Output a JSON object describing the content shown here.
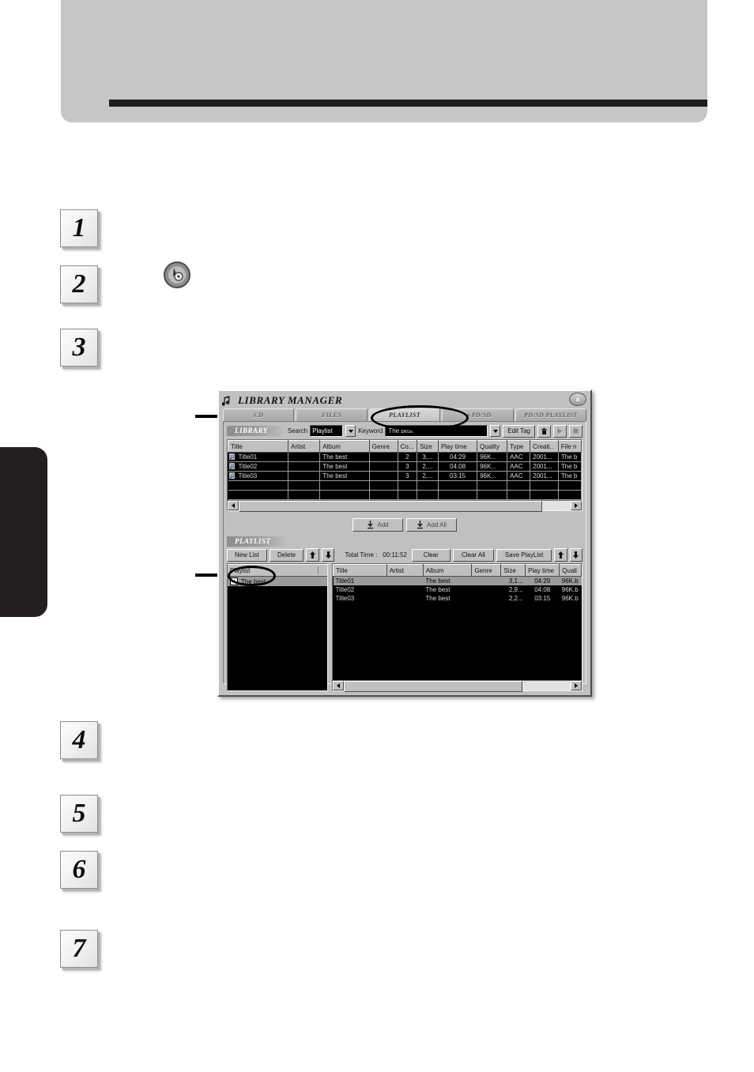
{
  "page": {
    "steps": [
      "1",
      "2",
      "3",
      "4",
      "5",
      "6",
      "7"
    ]
  },
  "window": {
    "title": "LIBRARY MANAGER",
    "title_icon": "music-note-icon",
    "close_label": "×",
    "tabs": [
      {
        "label": "CD",
        "active": false
      },
      {
        "label": "FILES",
        "active": false
      },
      {
        "label": "PLAYLIST",
        "active": true
      },
      {
        "label": "⇒ PD/SD",
        "active": false
      },
      {
        "label": "PD/SD PLAYLIST",
        "active": false
      }
    ]
  },
  "library": {
    "banner": "LIBRARY",
    "search_label": "Search",
    "search_value": "Playlist",
    "keyword_label": "Keyword",
    "keyword_value": "The best",
    "edit_tag_label": "Edit Tag",
    "delete_icon": "trash-icon",
    "play_icon": "play-icon",
    "stop_icon": "stop-icon",
    "columns": [
      "Title",
      "Artist",
      "Album",
      "Genre",
      "Co...",
      "Size",
      "Play time",
      "Quality",
      "Type",
      "Creati..",
      "File n"
    ],
    "rows": [
      {
        "title": "Title01",
        "artist": "",
        "album": "The best",
        "genre": "",
        "count": "2",
        "size": "3,...",
        "playtime": "04:29",
        "quality": "96K...",
        "type": "AAC",
        "created": "2001...",
        "filename": "The b"
      },
      {
        "title": "Title02",
        "artist": "",
        "album": "The best",
        "genre": "",
        "count": "3",
        "size": "2,...",
        "playtime": "04:08",
        "quality": "96K...",
        "type": "AAC",
        "created": "2001...",
        "filename": "The b"
      },
      {
        "title": "Title03",
        "artist": "",
        "album": "The best",
        "genre": "",
        "count": "3",
        "size": "2,...",
        "playtime": "03:15",
        "quality": "96K...",
        "type": "AAC",
        "created": "2001...",
        "filename": "The b"
      }
    ]
  },
  "transfer": {
    "add_label": "Add",
    "add_all_label": "Add All"
  },
  "playlist": {
    "banner": "PLAYLIST",
    "new_list_label": "New List",
    "delete_label": "Delete",
    "move_up_icon": "arrow-up-icon",
    "move_down_icon": "arrow-down-icon",
    "total_time_label": "Total Time :",
    "total_time_value": "00:11:52",
    "clear_label": "Clear",
    "clear_all_label": "Clear All",
    "save_playlist_label": "Save PlayList",
    "list_header": "Playlist",
    "items": [
      {
        "name": "The best",
        "checked": true
      }
    ],
    "columns": [
      "Title",
      "Artist",
      "Album",
      "Genre",
      "Size",
      "Play time",
      "Quali"
    ],
    "tracks": [
      {
        "title": "Title01",
        "artist": "",
        "album": "The best",
        "genre": "",
        "size": "3,1...",
        "playtime": "04:29",
        "quality": "96K.b"
      },
      {
        "title": "Title02",
        "artist": "",
        "album": "The best",
        "genre": "",
        "size": "2,9...",
        "playtime": "04:08",
        "quality": "96K.b"
      },
      {
        "title": "Title03",
        "artist": "",
        "album": "The best",
        "genre": "",
        "size": "2,2...",
        "playtime": "03:15",
        "quality": "96K.b"
      }
    ]
  },
  "colors": {
    "window_face": "#c0c0c0",
    "grid_bg": "#000000",
    "header_band": "#c6c6c6",
    "thumb_index": "#231f20"
  }
}
